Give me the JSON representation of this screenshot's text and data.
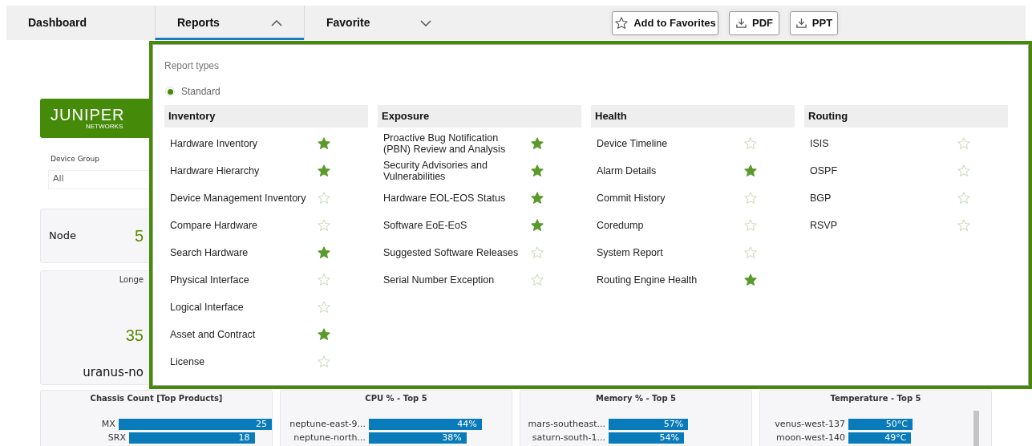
{
  "nav": {
    "tabs": [
      {
        "label": "Dashboard",
        "selected": false,
        "kind": "plain"
      },
      {
        "label": "Reports",
        "selected": true,
        "kind": "dropdown",
        "expanded": true
      },
      {
        "label": "Favorite",
        "selected": false,
        "kind": "dropdown",
        "expanded": false
      }
    ],
    "buttons": [
      {
        "label": "Add to Favorites",
        "kind": "star"
      },
      {
        "label": "PDF",
        "kind": "download"
      },
      {
        "label": "PPT",
        "kind": "download"
      }
    ]
  },
  "dashboard": {
    "logo": {
      "name": "JUNIPER",
      "sub": "NETWORKS"
    },
    "device_group": {
      "label": "Device Group",
      "value": "All"
    },
    "node_card": {
      "label": "Node",
      "value": "5"
    },
    "longest_card": {
      "title": "Longe",
      "value": "35",
      "device": "uranus-no"
    },
    "charts": [
      {
        "title": "Chassis Count [Top Products]",
        "rows": [
          {
            "label": "MX",
            "value": "25"
          },
          {
            "label": "SRX",
            "value": "18"
          }
        ]
      },
      {
        "title": "CPU % - Top 5",
        "rows": [
          {
            "label": "neptune-east-9...",
            "value": "44%"
          },
          {
            "label": "neptune-north...",
            "value": "38%"
          }
        ]
      },
      {
        "title": "Memory % - Top 5",
        "rows": [
          {
            "label": "mars-southeast...",
            "value": "57%"
          },
          {
            "label": "saturn-south-1...",
            "value": "54%"
          }
        ]
      },
      {
        "title": "Temperature - Top 5",
        "rows": [
          {
            "label": "venus-west-137",
            "value": "50°C"
          },
          {
            "label": "moon-west-140",
            "value": "49°C"
          }
        ]
      }
    ]
  },
  "reports_menu": {
    "title": "Report types",
    "options": [
      {
        "label": "Standard",
        "selected": true
      }
    ],
    "columns": [
      {
        "heading": "Inventory",
        "items": [
          {
            "label": "Hardware Inventory",
            "favorite": true
          },
          {
            "label": "Hardware Hierarchy",
            "favorite": true
          },
          {
            "label": "Device Management Inventory",
            "favorite": false
          },
          {
            "label": "Compare Hardware",
            "favorite": false
          },
          {
            "label": "Search Hardware",
            "favorite": true
          },
          {
            "label": "Physical Interface",
            "favorite": false
          },
          {
            "label": "Logical Interface",
            "favorite": false
          },
          {
            "label": "Asset and Contract",
            "favorite": true
          },
          {
            "label": "License",
            "favorite": false
          }
        ]
      },
      {
        "heading": "Exposure",
        "items": [
          {
            "label": "Proactive Bug Notification (PBN) Review and Analysis",
            "favorite": true
          },
          {
            "label": "Security Advisories and Vulnerabilities",
            "favorite": true
          },
          {
            "label": "Hardware EOL-EOS Status",
            "favorite": true
          },
          {
            "label": "Software EoE-EoS",
            "favorite": true
          },
          {
            "label": "Suggested Software Releases",
            "favorite": false
          },
          {
            "label": "Serial Number Exception",
            "favorite": false
          }
        ]
      },
      {
        "heading": "Health",
        "items": [
          {
            "label": "Device Timeline",
            "favorite": false
          },
          {
            "label": "Alarm Details",
            "favorite": true
          },
          {
            "label": "Commit History",
            "favorite": false
          },
          {
            "label": "Coredump",
            "favorite": false
          },
          {
            "label": "System Report",
            "favorite": false
          },
          {
            "label": "Routing Engine Health",
            "favorite": true
          }
        ]
      },
      {
        "heading": "Routing",
        "items": [
          {
            "label": "ISIS",
            "favorite": false
          },
          {
            "label": "OSPF",
            "favorite": false
          },
          {
            "label": "BGP",
            "favorite": false
          },
          {
            "label": "RSVP",
            "favorite": false
          }
        ]
      }
    ]
  }
}
